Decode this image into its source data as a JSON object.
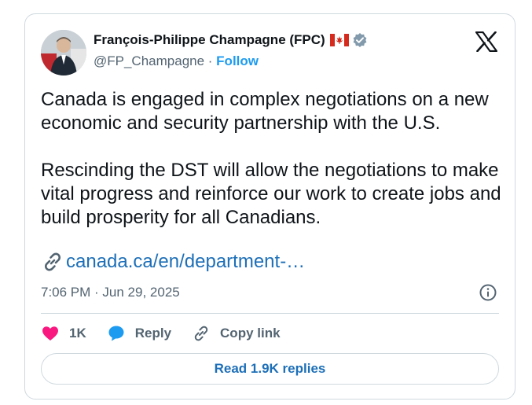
{
  "author": {
    "name": "François-Philippe Champagne (FPC)",
    "handle": "@FP_Champagne",
    "separator": " · ",
    "follow_label": "Follow"
  },
  "icons": {
    "avatar": "profile-photo",
    "flag": "canada-flag-icon",
    "verified": "verified-badge-icon",
    "brand": "x-logo-icon",
    "link": "link-icon",
    "info": "info-icon",
    "like": "heart-icon",
    "reply": "speech-bubble-icon",
    "copy": "link-icon"
  },
  "tweet": {
    "paragraphs": [
      "Canada is engaged in complex negotiations on a new economic and security partnership with the U.S.",
      "Rescinding the DST will allow the negotiations to make vital progress and reinforce our work to create jobs and build prosperity for all Canadians."
    ],
    "link_text": "canada.ca/en/department-…",
    "timestamp": "7:06 PM · Jun 29, 2025"
  },
  "actions": {
    "like_count": "1K",
    "reply_label": "Reply",
    "copy_label": "Copy link"
  },
  "replies_button": "Read 1.9K replies",
  "colors": {
    "like": "#f91880",
    "reply": "#1d9bf0",
    "link": "#1d6fb8",
    "muted": "#536471",
    "border": "#cfd9de"
  }
}
